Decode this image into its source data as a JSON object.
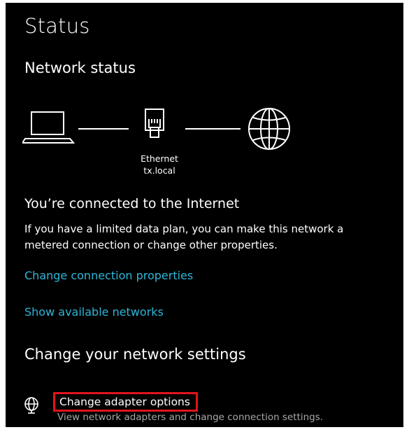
{
  "header": {
    "title": "Status"
  },
  "network_status": {
    "heading": "Network status",
    "adapter_name": "Ethernet",
    "domain": "tx.local",
    "icons": [
      "laptop-icon",
      "ethernet-icon",
      "globe-icon"
    ]
  },
  "connection": {
    "title": "You’re connected to the Internet",
    "description": "If you have a limited data plan, you can make this network a metered connection or change other properties."
  },
  "links": {
    "change_connection_properties": "Change connection properties",
    "show_available_networks": "Show available networks"
  },
  "settings": {
    "heading": "Change your network settings",
    "adapter_options_title": "Change adapter options",
    "adapter_options_description": "View network adapters and change connection settings.",
    "adapter_icon": "adapter-globe-icon"
  },
  "colors": {
    "background": "#000000",
    "text": "#ffffff",
    "link": "#2eb6d8",
    "highlight_box": "#e0151b",
    "secondary_text": "#a8a8a8"
  }
}
